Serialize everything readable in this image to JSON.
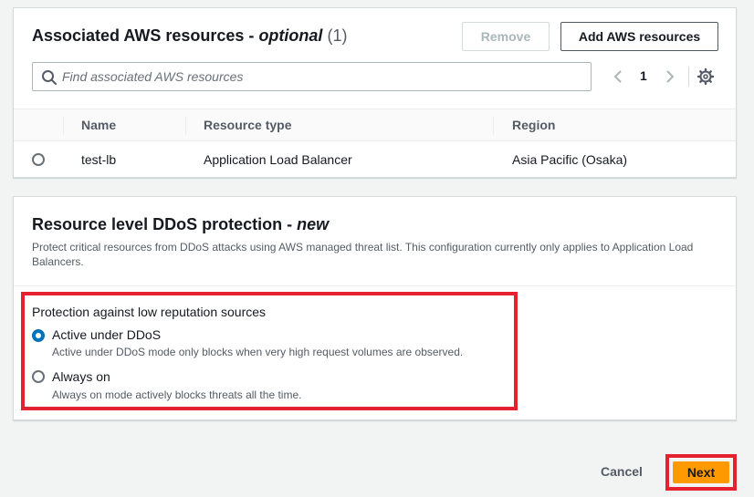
{
  "associated": {
    "title": "Associated AWS resources - ",
    "title_emphasis": "optional",
    "count": "(1)",
    "remove_label": "Remove",
    "add_label": "Add AWS resources",
    "search_placeholder": "Find associated AWS resources",
    "page": "1",
    "columns": [
      "Name",
      "Resource type",
      "Region"
    ],
    "rows": [
      {
        "name": "test-lb",
        "type": "Application Load Balancer",
        "region": "Asia Pacific (Osaka)"
      }
    ]
  },
  "ddos": {
    "title": "Resource level DDoS protection - ",
    "title_emphasis": "new",
    "description": "Protect critical resources from DDoS attacks using AWS managed threat list. This configuration currently only applies to Application Load Balancers.",
    "legend": "Protection against low reputation sources",
    "options": [
      {
        "label": "Active under DDoS",
        "desc": "Active under DDoS mode only blocks when very high request volumes are observed.",
        "selected": true
      },
      {
        "label": "Always on",
        "desc": "Always on mode actively blocks threats all the time.",
        "selected": false
      }
    ]
  },
  "footer": {
    "cancel_label": "Cancel",
    "next_label": "Next"
  },
  "colors": {
    "accent": "#ff9900",
    "selected_radio": "#0073bb",
    "highlight": "#e5212f"
  },
  "icons": {
    "search": "search-icon",
    "prev": "chevron-left-icon",
    "next": "chevron-right-icon",
    "settings": "gear-icon"
  }
}
